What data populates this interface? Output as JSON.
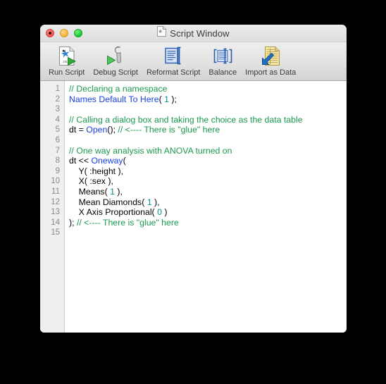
{
  "window": {
    "title": "Script Window",
    "title_icon": "script-document-icon",
    "traffic_lights": [
      {
        "name": "close-button",
        "color": "#f2564c"
      },
      {
        "name": "minimize-button",
        "color": "#f6b033"
      },
      {
        "name": "maximize-button",
        "color": "#17c436"
      }
    ]
  },
  "toolbar": {
    "items": [
      {
        "label": "Run Script",
        "icon": "run-script-icon"
      },
      {
        "label": "Debug Script",
        "icon": "debug-script-icon"
      },
      {
        "label": "Reformat Script",
        "icon": "reformat-script-icon"
      },
      {
        "label": "Balance",
        "icon": "balance-icon"
      },
      {
        "label": "Import as Data",
        "icon": "import-as-data-icon"
      }
    ]
  },
  "editor": {
    "line_numbers": [
      "1",
      "2",
      "3",
      "4",
      "5",
      "6",
      "7",
      "8",
      "9",
      "10",
      "11",
      "12",
      "13",
      "14",
      "15"
    ],
    "lines": [
      {
        "n": "1",
        "tokens": [
          {
            "t": "// Declaring a namespace",
            "c": "comment"
          }
        ]
      },
      {
        "n": "2",
        "tokens": [
          {
            "t": "Names Default To Here",
            "c": "kw"
          },
          {
            "t": "( ",
            "c": "plain"
          },
          {
            "t": "1",
            "c": "num"
          },
          {
            "t": " );",
            "c": "plain"
          }
        ]
      },
      {
        "n": "3",
        "tokens": []
      },
      {
        "n": "4",
        "tokens": [
          {
            "t": "// Calling a dialog box and taking the choice as the data table",
            "c": "comment"
          }
        ]
      },
      {
        "n": "5",
        "tokens": [
          {
            "t": "dt = ",
            "c": "plain"
          },
          {
            "t": "Open",
            "c": "kw"
          },
          {
            "t": "(); ",
            "c": "plain"
          },
          {
            "t": "// <---- There is \"glue\" here",
            "c": "comment"
          }
        ]
      },
      {
        "n": "6",
        "tokens": []
      },
      {
        "n": "7",
        "tokens": [
          {
            "t": "// One way analysis with ANOVA turned on",
            "c": "comment"
          }
        ]
      },
      {
        "n": "8",
        "tokens": [
          {
            "t": "dt << ",
            "c": "plain"
          },
          {
            "t": "Oneway",
            "c": "kw"
          },
          {
            "t": "(",
            "c": "plain"
          }
        ]
      },
      {
        "n": "9",
        "tokens": [
          {
            "t": "    Y( :height ),",
            "c": "plain"
          }
        ]
      },
      {
        "n": "10",
        "tokens": [
          {
            "t": "    X( :sex ),",
            "c": "plain"
          }
        ]
      },
      {
        "n": "11",
        "tokens": [
          {
            "t": "    Means( ",
            "c": "plain"
          },
          {
            "t": "1",
            "c": "num"
          },
          {
            "t": " ),",
            "c": "plain"
          }
        ]
      },
      {
        "n": "12",
        "tokens": [
          {
            "t": "    Mean Diamonds( ",
            "c": "plain"
          },
          {
            "t": "1",
            "c": "num"
          },
          {
            "t": " ),",
            "c": "plain"
          }
        ]
      },
      {
        "n": "13",
        "tokens": [
          {
            "t": "    X Axis Proportional( ",
            "c": "plain"
          },
          {
            "t": "0",
            "c": "num"
          },
          {
            "t": " )",
            "c": "plain"
          }
        ]
      },
      {
        "n": "14",
        "tokens": [
          {
            "t": "); ",
            "c": "plain"
          },
          {
            "t": "// <---- There is \"glue\" here",
            "c": "comment"
          }
        ]
      },
      {
        "n": "15",
        "tokens": []
      }
    ]
  },
  "colors": {
    "comment": "#1a9a4e",
    "keyword": "#1a42e8",
    "number": "#00918f",
    "plain": "#000000",
    "gutter_bg": "#efefef",
    "gutter_text": "#8a8a8a",
    "toolbar_bg": "#e2e2e2",
    "page_bg": "#000000"
  }
}
